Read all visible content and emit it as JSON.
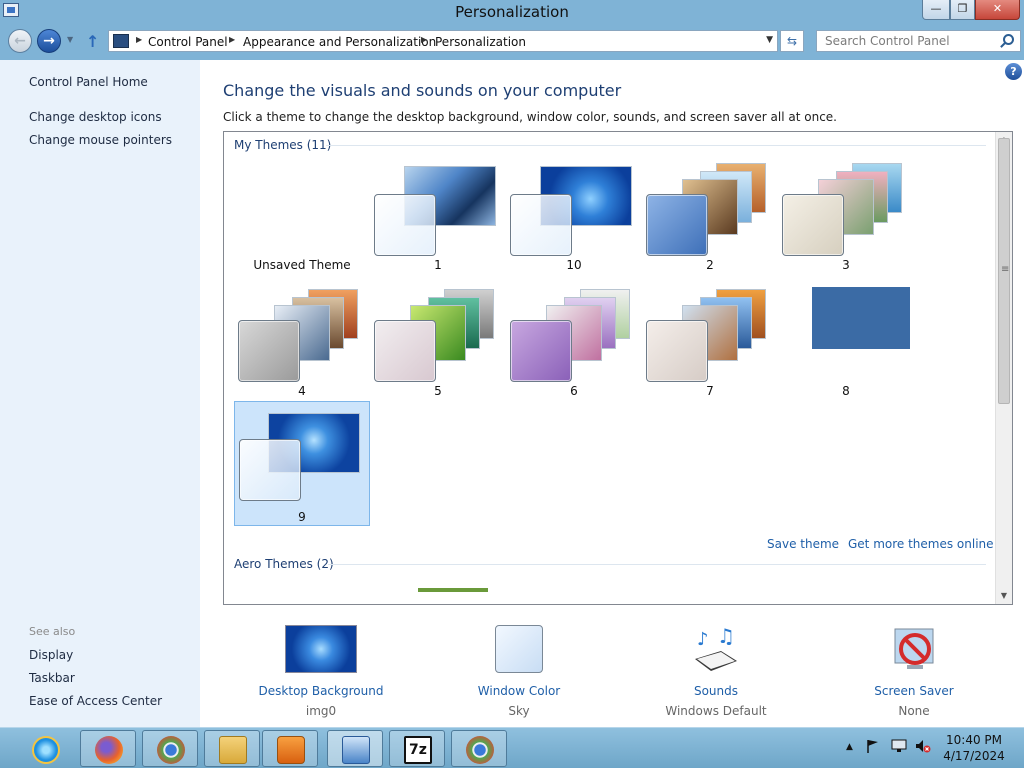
{
  "window": {
    "title": "Personalization",
    "minimize_label": "—",
    "maximize_label": "❐",
    "close_label": "✕"
  },
  "navbar": {
    "back_glyph": "←",
    "forward_glyph": "→",
    "up_glyph": "↑",
    "breadcrumbs": [
      "Control Panel",
      "Appearance and Personalization",
      "Personalization"
    ],
    "search_placeholder": "Search Control Panel"
  },
  "sidebar": {
    "links": [
      "Control Panel Home",
      "Change desktop icons",
      "Change mouse pointers"
    ],
    "see_also_header": "See also",
    "see_also_links": [
      "Display",
      "Taskbar",
      "Ease of Access Center"
    ]
  },
  "main": {
    "heading": "Change the visuals and sounds on your computer",
    "description": "Click a theme to change the desktop background, window color, sounds, and screen saver all at once.",
    "help_glyph": "?"
  },
  "themes": {
    "my_themes_title": "My Themes (11)",
    "aero_themes_title": "Aero Themes (2)",
    "items": [
      {
        "label": "Unsaved Theme",
        "selected": false,
        "wallpaper": "none"
      },
      {
        "label": "1",
        "selected": false,
        "wallpaper": "fan"
      },
      {
        "label": "10",
        "selected": false,
        "wallpaper": "windows-logo"
      },
      {
        "label": "2",
        "selected": false,
        "wallpaper": "stacked-sunset"
      },
      {
        "label": "3",
        "selected": false,
        "wallpaper": "stacked-flowers"
      },
      {
        "label": "4",
        "selected": false,
        "wallpaper": "stacked-landscape"
      },
      {
        "label": "5",
        "selected": false,
        "wallpaper": "stacked-green"
      },
      {
        "label": "6",
        "selected": false,
        "wallpaper": "stacked-art"
      },
      {
        "label": "7",
        "selected": false,
        "wallpaper": "stacked-coast"
      },
      {
        "label": "8",
        "selected": false,
        "wallpaper": "solid-blue"
      },
      {
        "label": "9",
        "selected": true,
        "wallpaper": "windows-logo"
      }
    ],
    "save_theme_label": "Save theme",
    "get_more_label": "Get more themes online"
  },
  "settings": [
    {
      "name": "Desktop Background",
      "value": "img0",
      "icon": "desktop-background-icon"
    },
    {
      "name": "Window Color",
      "value": "Sky",
      "icon": "window-color-icon"
    },
    {
      "name": "Sounds",
      "value": "Windows Default",
      "icon": "sounds-icon"
    },
    {
      "name": "Screen Saver",
      "value": "None",
      "icon": "screen-saver-icon"
    }
  ],
  "taskbar": {
    "apps": [
      "internet-explorer-icon",
      "firefox-icon",
      "chrome-icon",
      "file-explorer-icon",
      "media-player-icon",
      "control-panel-icon",
      "7zip-icon",
      "chrome-icon"
    ],
    "seven_zip_label": "7z",
    "time": "10:40 PM",
    "date": "4/17/2024"
  },
  "colors": {
    "accent": "#1f5fa8",
    "heading": "#1e3f73",
    "selection": "#cce4fb",
    "titlebar": "#7fb3d6"
  }
}
